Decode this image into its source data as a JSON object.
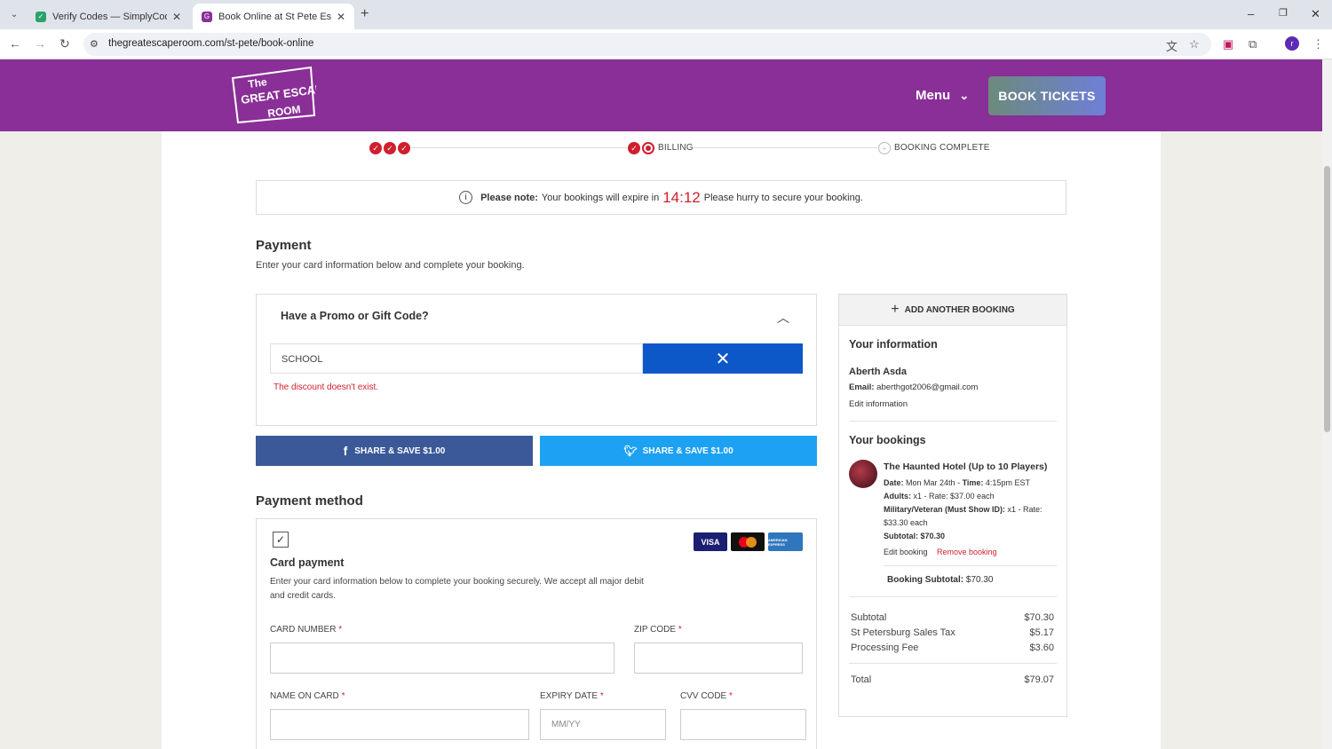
{
  "browser": {
    "tabs": [
      {
        "title": "Verify Codes — SimplyCodes",
        "active": false
      },
      {
        "title": "Book Online at St Pete Escape R",
        "active": true
      }
    ],
    "url": "thegreatescaperoom.com/st-pete/book-online"
  },
  "header": {
    "logo": [
      "The",
      "GREAT ESCAPE",
      "ROOM"
    ],
    "menu_label": "Menu",
    "book_label": "BOOK TICKETS"
  },
  "steps": {
    "billing": "BILLING",
    "complete": "BOOKING COMPLETE"
  },
  "notice": {
    "bold": "Please note:",
    "before": "Your bookings will expire in",
    "timer": "14:12",
    "after": "Please hurry to secure your booking."
  },
  "payment": {
    "title": "Payment",
    "subtitle": "Enter your card information below and complete your booking."
  },
  "promo": {
    "title": "Have a Promo or Gift Code?",
    "value": "SCHOOL",
    "error": "The discount doesn't exist."
  },
  "share": {
    "facebook": "SHARE & SAVE $1.00",
    "twitter": "SHARE & SAVE $1.00"
  },
  "method": {
    "title": "Payment method",
    "card_title": "Card payment",
    "card_desc_1": "Enter your card information below to complete your booking securely. We accept all major debit",
    "card_desc_2": "and credit cards.",
    "cards": [
      "VISA",
      "",
      "AMERICAN EXPRESS"
    ]
  },
  "fields": {
    "card_number": "CARD NUMBER",
    "zip": "ZIP CODE",
    "name": "NAME ON CARD",
    "expiry": "EXPIRY DATE",
    "expiry_placeholder": "MM/YY",
    "cvv": "CVV CODE",
    "required": "*"
  },
  "sidebar": {
    "add_booking": "ADD ANOTHER BOOKING",
    "info_title": "Your information",
    "name": "Aberth Asda",
    "email_label": "Email:",
    "email": "aberthgot2006@gmail.com",
    "edit_info": "Edit information",
    "bookings_title": "Your bookings",
    "booking": {
      "title": "The Haunted Hotel (Up to 10 Players)",
      "date_label": "Date:",
      "date": "Mon Mar 24th",
      "time_label": "Time:",
      "time": "4:15pm EST",
      "adults_label": "Adults:",
      "adults": "x1 - Rate: $37.00 each",
      "military_label": "Military/Veteran (Must Show ID):",
      "military": "x1 - Rate:",
      "military_rate": "$33.30 each",
      "subtotal_label": "Subtotal:",
      "subtotal": "$70.30",
      "edit": "Edit booking",
      "remove": "Remove booking"
    },
    "booking_subtotal_label": "Booking Subtotal:",
    "booking_subtotal": "$70.30",
    "totals": [
      {
        "label": "Subtotal",
        "value": "$70.30"
      },
      {
        "label": "St Petersburg Sales Tax",
        "value": "$5.17"
      },
      {
        "label": "Processing Fee",
        "value": "$3.60"
      }
    ],
    "total_label": "Total",
    "total": "$79.07"
  },
  "colors": {
    "brand": "#8a2f97",
    "accent": "#0d58c8",
    "error": "#d01f2d",
    "facebook": "#3b5998",
    "twitter": "#1da1f2"
  }
}
